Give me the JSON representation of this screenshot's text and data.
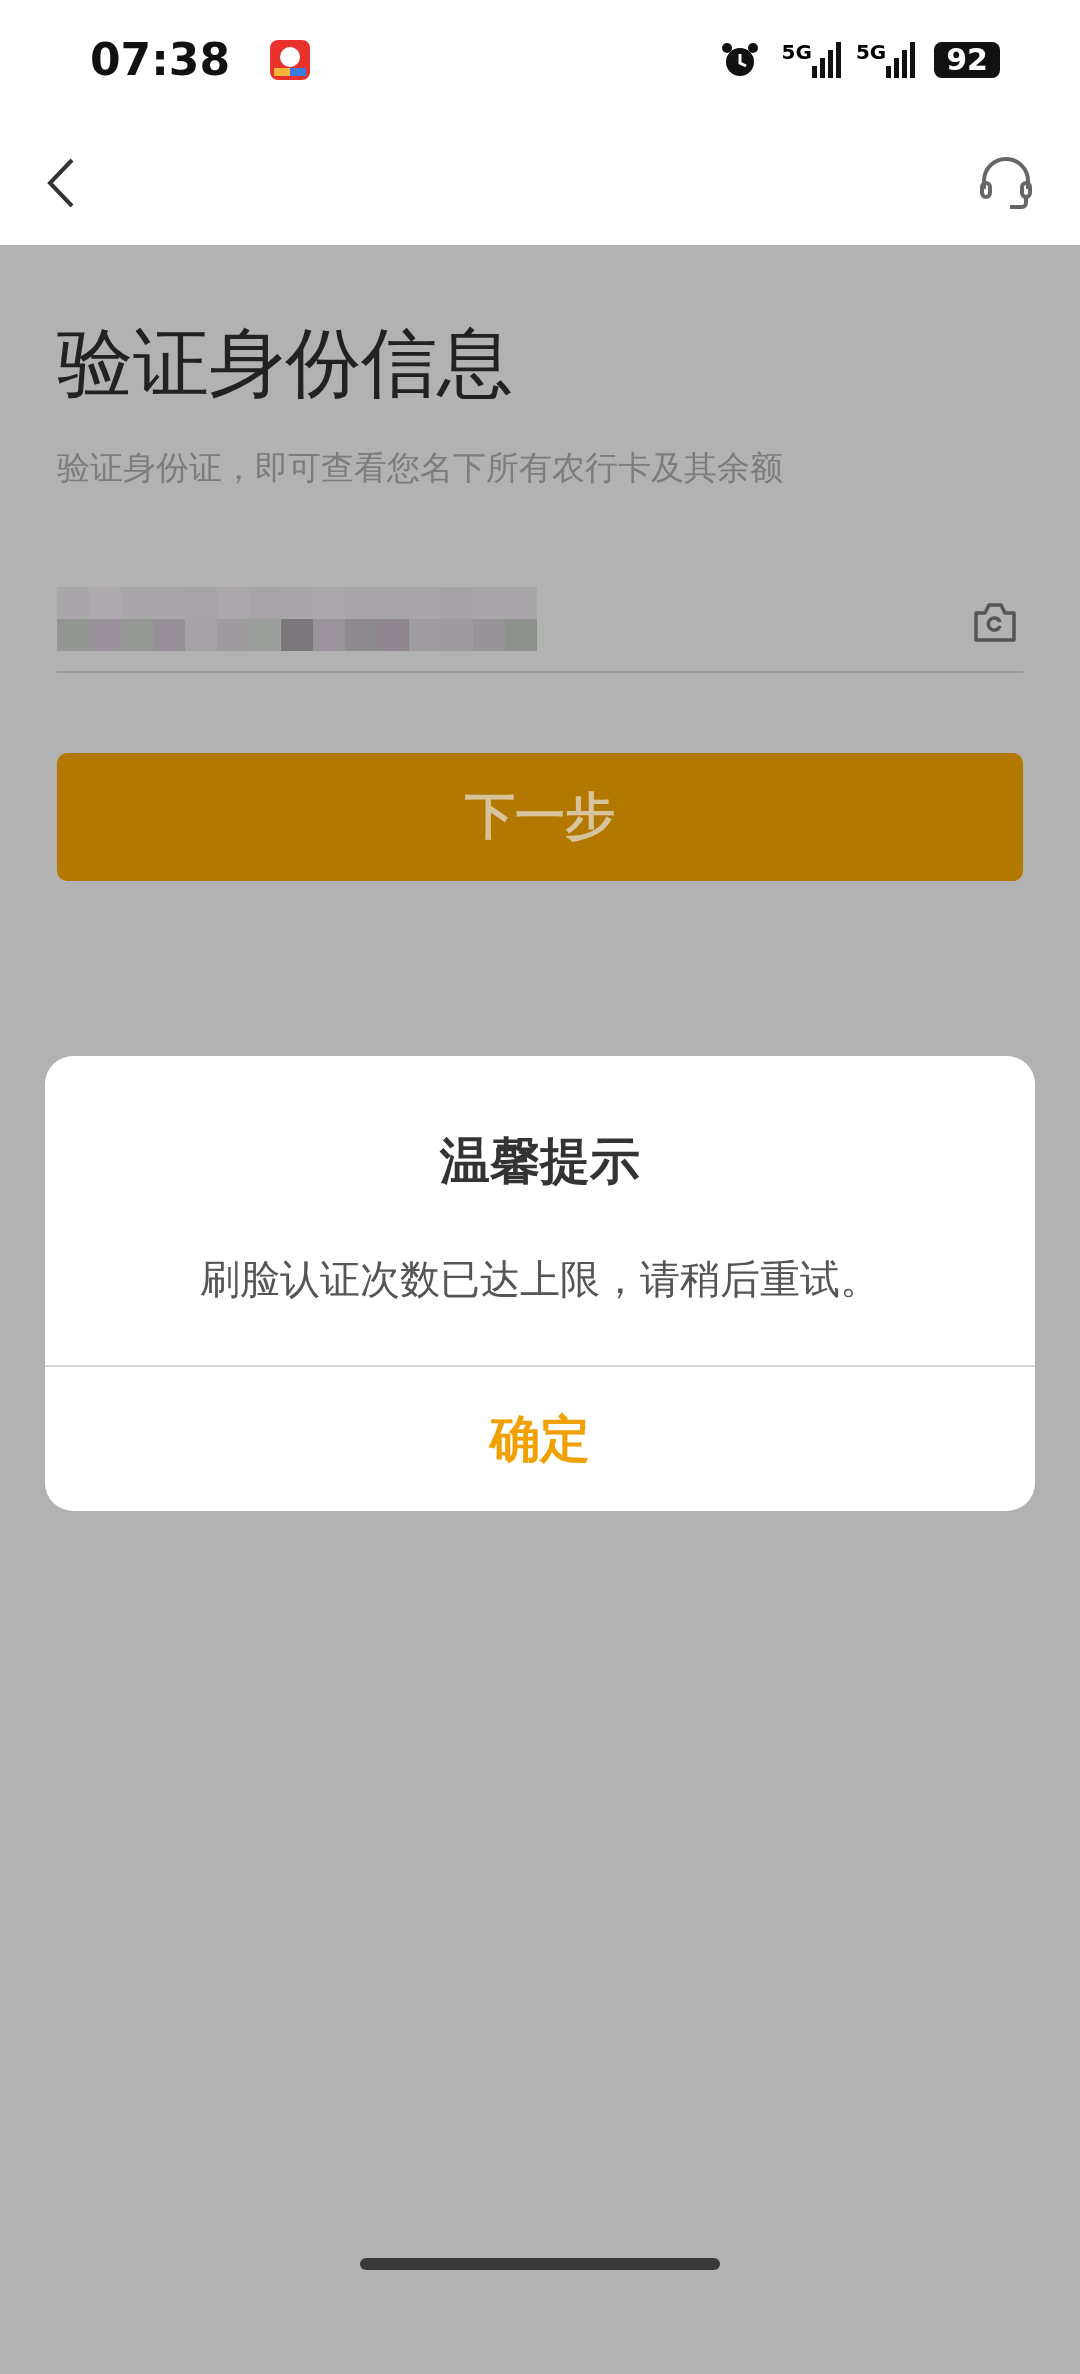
{
  "status_bar": {
    "time": "07:38",
    "network_1": "5G",
    "network_2": "5G",
    "battery": "92"
  },
  "page": {
    "title": "验证身份信息",
    "subtitle": "验证身份证，即可查看您名下所有农行卡及其余额",
    "next_button": "下一步"
  },
  "dialog": {
    "title": "温馨提示",
    "message": "刷脸认证次数已达上限，请稍后重试。",
    "confirm_button": "确定"
  }
}
